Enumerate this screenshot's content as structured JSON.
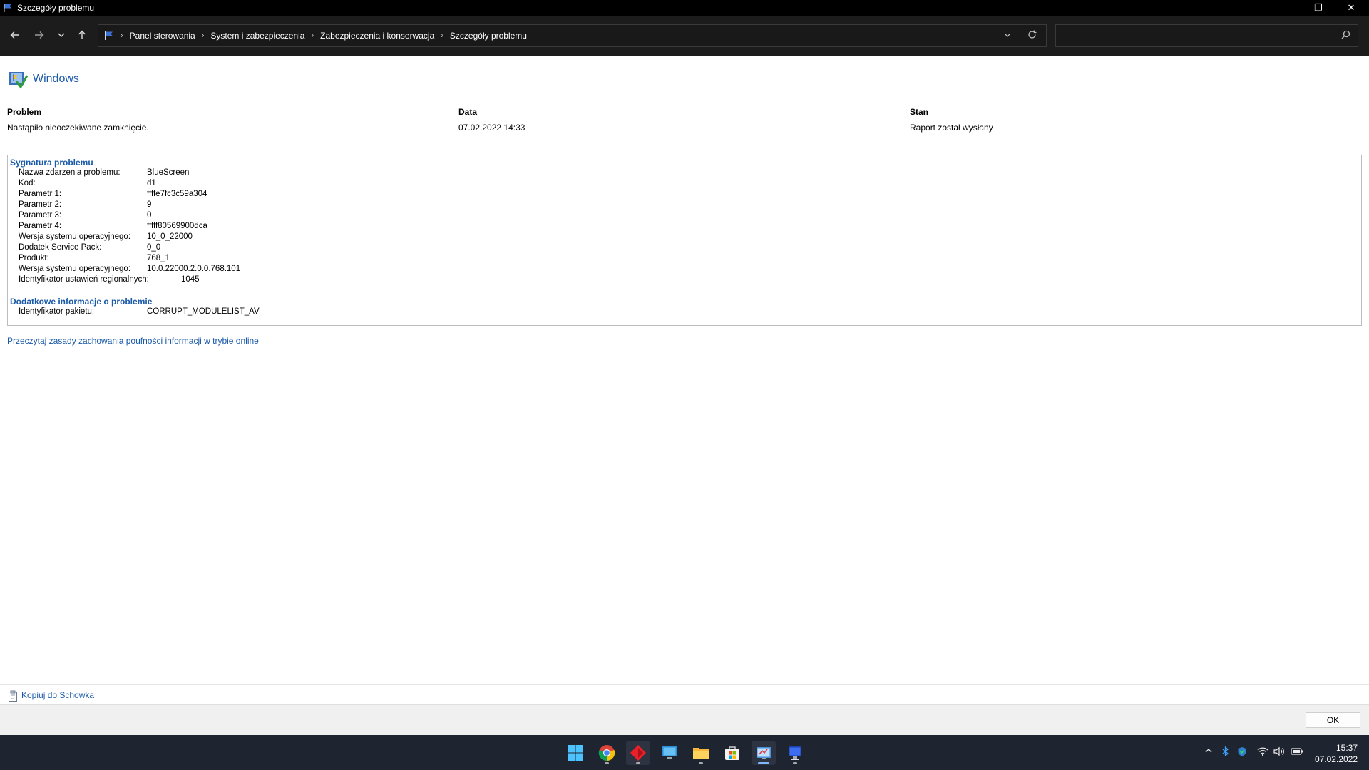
{
  "window": {
    "title": "Szczegóły problemu",
    "minimize_glyph": "—",
    "restore_glyph": "❐",
    "close_glyph": "✕"
  },
  "nav": {
    "back_icon": "back-arrow-icon",
    "forward_icon": "forward-arrow-icon",
    "recent_icon": "chevron-down-icon",
    "up_icon": "up-arrow-icon"
  },
  "address": {
    "breadcrumbs": [
      "Panel sterowania",
      "System i zabezpieczenia",
      "Zabezpieczenia i konserwacja",
      "Szczegóły problemu"
    ],
    "search_value": ""
  },
  "header": {
    "product": "Windows"
  },
  "summary": {
    "problem_label": "Problem",
    "problem_value": "Nastąpiło nieoczekiwane zamknięcie.",
    "date_label": "Data",
    "date_value": "07.02.2022 14:33",
    "status_label": "Stan",
    "status_value": "Raport został wysłany"
  },
  "signature": {
    "heading": "Sygnatura problemu",
    "rows": [
      {
        "key": "Nazwa zdarzenia problemu:",
        "value": "BlueScreen"
      },
      {
        "key": "Kod:",
        "value": "d1"
      },
      {
        "key": "Parametr 1:",
        "value": "ffffe7fc3c59a304"
      },
      {
        "key": "Parametr 2:",
        "value": "9"
      },
      {
        "key": "Parametr 3:",
        "value": "0"
      },
      {
        "key": "Parametr 4:",
        "value": "fffff80569900dca"
      },
      {
        "key": "Wersja systemu operacyjnego:",
        "value": "10_0_22000"
      },
      {
        "key": "Dodatek Service Pack:",
        "value": "0_0"
      },
      {
        "key": "Produkt:",
        "value": "768_1"
      },
      {
        "key": "Wersja systemu operacyjnego:",
        "value": "10.0.22000.2.0.0.768.101"
      },
      {
        "key": "Identyfikator ustawień regionalnych:",
        "value": "1045"
      }
    ]
  },
  "additional": {
    "heading": "Dodatkowe informacje o problemie",
    "rows": [
      {
        "key": "Identyfikator pakietu:",
        "value": "CORRUPT_MODULELIST_AV"
      }
    ]
  },
  "links": {
    "privacy": "Przeczytaj zasady zachowania poufności informacji w trybie online"
  },
  "footer": {
    "copy_label": "Kopiuj do Schowka",
    "ok_label": "OK"
  },
  "taskbar": {
    "apps": [
      "start-icon",
      "chrome-icon",
      "red-diamond-app-icon",
      "desktop-icon",
      "file-explorer-icon",
      "store-icon",
      "control-panel-icon",
      "problem-reports-icon"
    ],
    "tray_icons": [
      "chevron-up-icon",
      "bluetooth-icon",
      "defender-icon",
      "wifi-icon",
      "volume-icon",
      "battery-icon"
    ],
    "time": "15:37",
    "date": "07.02.2022"
  },
  "colors": {
    "link_blue": "#1a5aa8",
    "titlebar": "#000000",
    "addressbar": "#1c1c1c",
    "taskbar": "#1f2530"
  }
}
